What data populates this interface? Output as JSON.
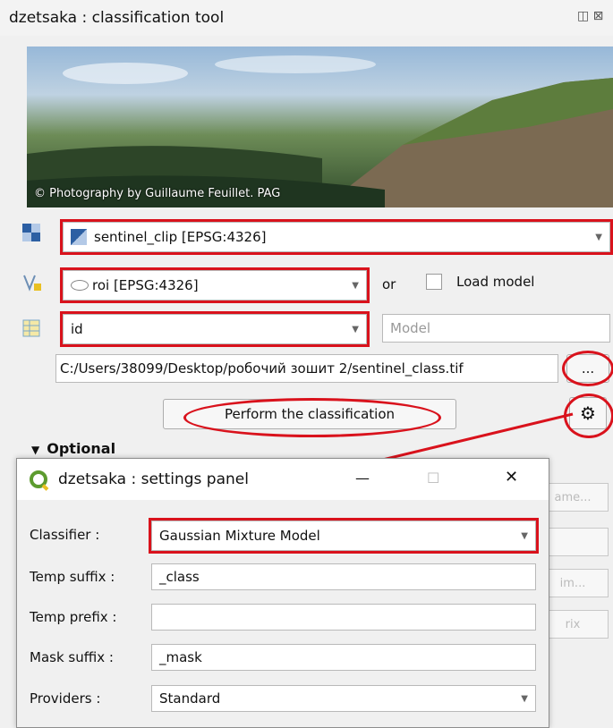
{
  "window": {
    "title": "dzetsaka : classification tool",
    "dock_icons": "◫ ⊠"
  },
  "banner": {
    "credit": "© Photography by Guillaume Feuillet. PAG"
  },
  "inputs": {
    "raster_layer": "sentinel_clip [EPSG:4326]",
    "roi_layer": "roi [EPSG:4326]",
    "or_label": "or",
    "load_model_label": "Load model",
    "field": "id",
    "model_placeholder": "Model",
    "output_path": "C:/Users/38099/Desktop/робочий зошит 2/sentinel_class.tif",
    "browse_label": "...",
    "perform_label": "Perform the classification",
    "optional_label": "Optional"
  },
  "partially_hidden_buttons": [
    "ame...",
    "im...",
    "rix"
  ],
  "settings_dialog": {
    "title": "dzetsaka : settings panel",
    "controls": {
      "minimize": "—",
      "maximize": "☐",
      "close": "✕"
    },
    "rows": [
      {
        "label": "Classifier :",
        "value": "Gaussian Mixture Model",
        "type": "combo"
      },
      {
        "label": "Temp suffix :",
        "value": "_class",
        "type": "text"
      },
      {
        "label": "Temp prefix :",
        "value": "",
        "type": "text"
      },
      {
        "label": "Mask suffix :",
        "value": "_mask",
        "type": "text"
      },
      {
        "label": "Providers :",
        "value": "Standard",
        "type": "combo"
      }
    ]
  },
  "colors": {
    "highlight_red": "#d9121c",
    "qgis_green": "#5c9b2e"
  }
}
